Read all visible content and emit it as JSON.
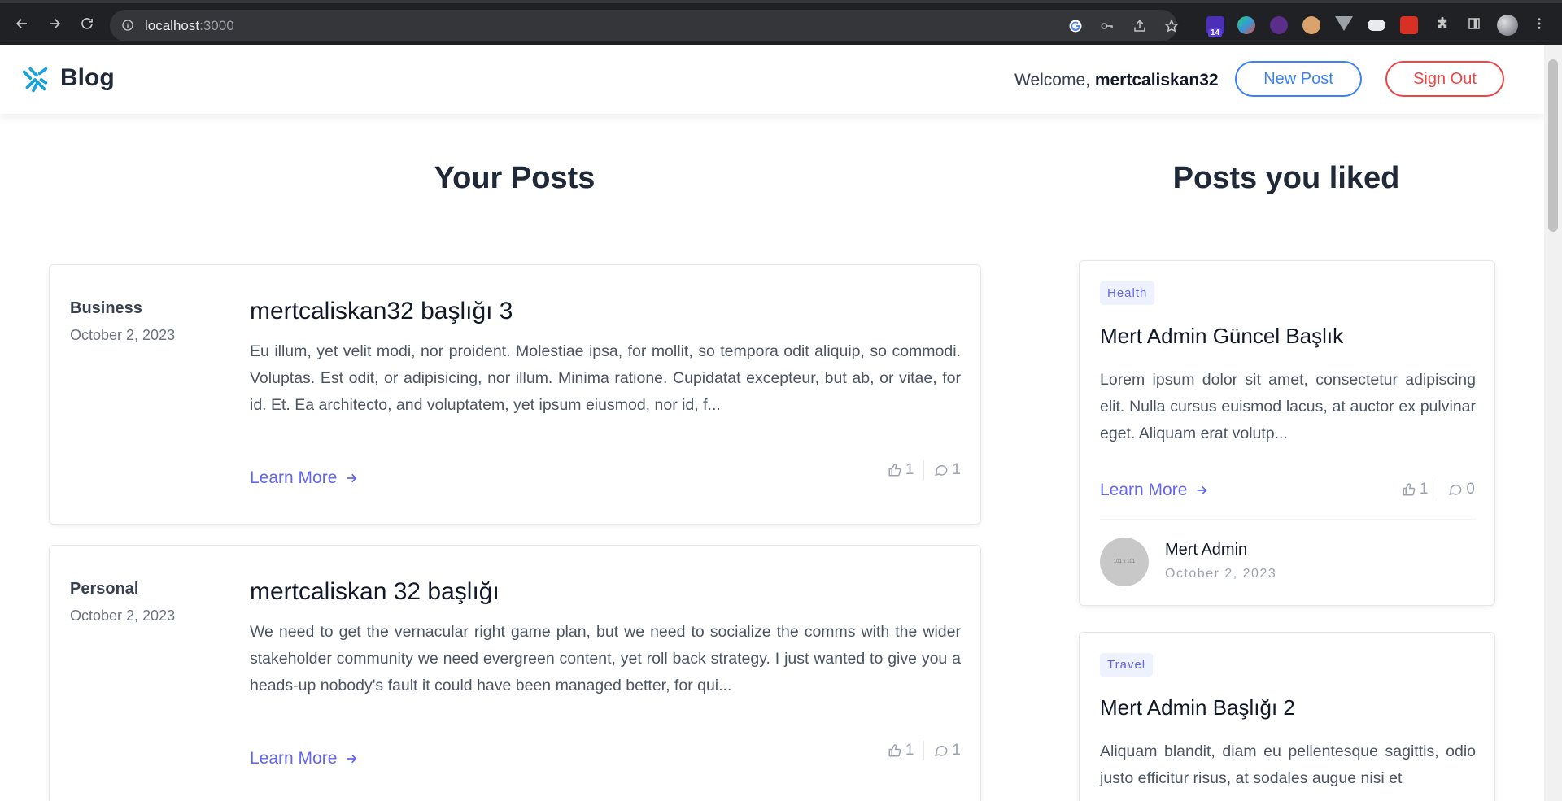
{
  "browser": {
    "url_host": "localhost",
    "url_port": ":3000",
    "extension_badge": "14"
  },
  "header": {
    "brand": "Blog",
    "welcome_prefix": "Welcome, ",
    "username": "mertcaliskan32",
    "new_post_label": "New Post",
    "sign_out_label": "Sign Out"
  },
  "your_posts": {
    "title": "Your Posts",
    "items": [
      {
        "category": "Business",
        "date": "October 2, 2023",
        "title": "mertcaliskan32 başlığı 3",
        "excerpt": "Eu illum, yet velit modi, nor proident. Molestiae ipsa, for mollit, so tempora odit aliquip, so commodi. Voluptas. Est odit, or adipisicing, nor illum. Minima ratione. Cupidatat excepteur, but ab, or vitae, for id. Et. Ea architecto, and voluptatem, yet ipsum eiusmod, nor id, f...",
        "learn_more": "Learn More",
        "likes": "1",
        "comments": "1"
      },
      {
        "category": "Personal",
        "date": "October 2, 2023",
        "title": "mertcaliskan 32 başlığı",
        "excerpt": "We need to get the vernacular right game plan, but we need to socialize the comms with the wider stakeholder community we need evergreen content, yet roll back strategy. I just wanted to give you a heads-up nobody's fault it could have been managed better, for qui...",
        "learn_more": "Learn More",
        "likes": "1",
        "comments": "1"
      }
    ]
  },
  "liked_posts": {
    "title": "Posts you liked",
    "items": [
      {
        "tag": "Health",
        "title": "Mert Admin Güncel Başlık",
        "excerpt": "Lorem ipsum dolor sit amet, consectetur adipiscing elit. Nulla cursus euismod lacus, at auctor ex pulvinar eget. Aliquam erat volutp...",
        "learn_more": "Learn More",
        "likes": "1",
        "comments": "0",
        "author": "Mert Admin",
        "author_date": "October 2, 2023",
        "avatar_text": "101 x 101"
      },
      {
        "tag": "Travel",
        "title": "Mert Admin Başlığı 2",
        "excerpt": "Aliquam blandit, diam eu pellentesque sagittis, odio justo efficitur risus, at sodales augue nisi et"
      }
    ]
  },
  "icons": {
    "back": "arrow-left-icon",
    "forward": "arrow-right-icon",
    "reload": "reload-icon",
    "info": "info-icon",
    "google": "google-icon",
    "key": "key-icon",
    "share": "share-icon",
    "star": "star-icon",
    "puzzle": "extensions-icon",
    "sidepanel": "side-panel-icon",
    "menu": "kebab-menu-icon",
    "like": "thumbs-up-icon",
    "comment": "comment-icon",
    "arrow": "arrow-right-icon"
  },
  "colors": {
    "accent": "#6366f1",
    "primary_button": "#3b82f6",
    "danger_button": "#ef4444",
    "logo": "#1aa3d9"
  }
}
